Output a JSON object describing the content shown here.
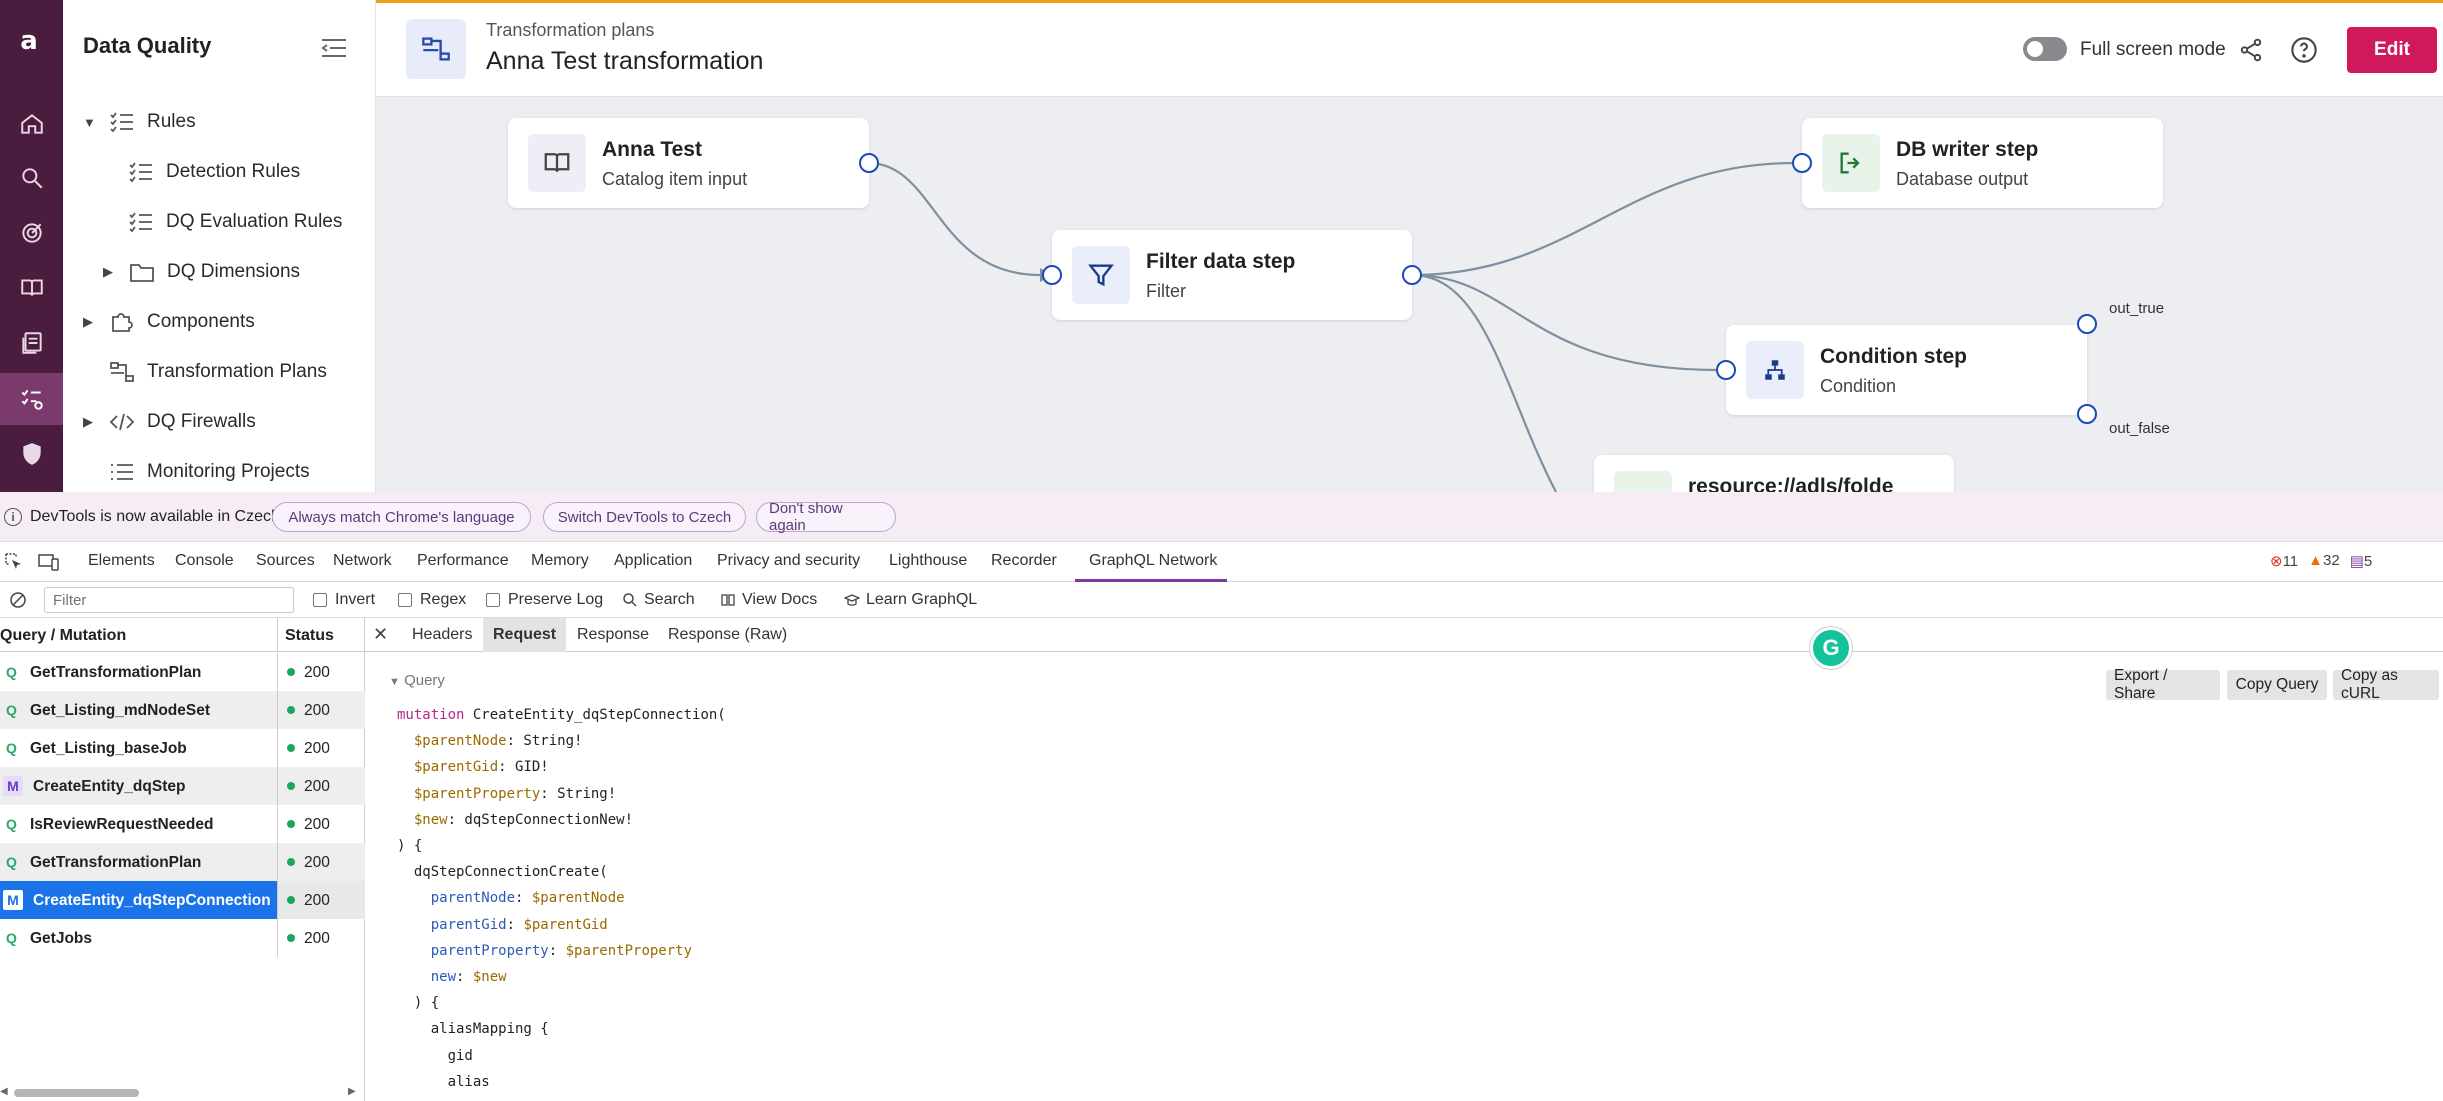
{
  "app": {
    "logo": "a",
    "sidenav": {
      "title": "Data Quality",
      "items": [
        {
          "label": "Rules",
          "caret": "▼"
        },
        {
          "label": "Detection Rules"
        },
        {
          "label": "DQ Evaluation Rules"
        },
        {
          "label": "DQ Dimensions",
          "caret": "▶"
        },
        {
          "label": "Components",
          "caret": "▶"
        },
        {
          "label": "Transformation Plans"
        },
        {
          "label": "DQ Firewalls",
          "caret": "▶"
        },
        {
          "label": "Monitoring Projects"
        }
      ]
    },
    "header": {
      "breadcrumb": "Transformation plans",
      "title": "Anna Test transformation",
      "fullscreen_label": "Full screen mode",
      "fullscreen_on": false,
      "edit_label": "Edit"
    },
    "nodes": [
      {
        "title": "Anna Test",
        "subtitle": "Catalog item input",
        "icon": "book-icon"
      },
      {
        "title": "Filter data step",
        "subtitle": "Filter",
        "icon": "filter-icon"
      },
      {
        "title": "DB writer step",
        "subtitle": "Database output",
        "icon": "output-icon"
      },
      {
        "title": "Condition step",
        "subtitle": "Condition",
        "icon": "hierarchy-icon"
      },
      {
        "title": "resource://adls/folde",
        "subtitle": "",
        "icon": ""
      }
    ],
    "port_labels": {
      "out_true": "out_true",
      "out_false": "out_false"
    },
    "colors": {
      "rail": "#4a1d3f",
      "edit_button": "#d0195d",
      "port": "#1a4bb4"
    }
  },
  "devtools": {
    "infobar": {
      "text": "DevTools is now available in Czech!",
      "buttons": [
        "Always match Chrome's language",
        "Switch DevTools to Czech",
        "Don't show again"
      ]
    },
    "tabs": [
      "Elements",
      "Console",
      "Sources",
      "Network",
      "Performance",
      "Memory",
      "Application",
      "Privacy and security",
      "Lighthouse",
      "Recorder",
      "GraphQL Network"
    ],
    "active_tab": "GraphQL Network",
    "counts": {
      "errors": "11",
      "warnings": "32",
      "messages": "5"
    },
    "toolbar": {
      "filter_placeholder": "Filter",
      "invert": "Invert",
      "regex": "Regex",
      "preserve_log": "Preserve Log",
      "search": "Search",
      "view_docs": "View Docs",
      "learn": "Learn GraphQL"
    },
    "list": {
      "col_name": "Query / Mutation",
      "col_status": "Status",
      "rows": [
        {
          "type": "Q",
          "name": "GetTransformationPlan",
          "status": "200"
        },
        {
          "type": "Q",
          "name": "Get_Listing_mdNodeSet",
          "status": "200"
        },
        {
          "type": "Q",
          "name": "Get_Listing_baseJob",
          "status": "200"
        },
        {
          "type": "M",
          "name": "CreateEntity_dqStep",
          "status": "200"
        },
        {
          "type": "Q",
          "name": "IsReviewRequestNeeded",
          "status": "200"
        },
        {
          "type": "Q",
          "name": "GetTransformationPlan",
          "status": "200"
        },
        {
          "type": "M",
          "name": "CreateEntity_dqStepConnection",
          "status": "200",
          "selected": true
        },
        {
          "type": "Q",
          "name": "GetJobs",
          "status": "200"
        }
      ]
    },
    "detail": {
      "close": "✕",
      "tabs": [
        "Headers",
        "Request",
        "Response",
        "Response (Raw)"
      ],
      "active_tab": "Request",
      "section": "Query",
      "actions": [
        "Export / Share",
        "Copy Query",
        "Copy as cURL"
      ],
      "grammarly": "G",
      "code": [
        "mutation CreateEntity_dqStepConnection(",
        "  $parentNode: String!",
        "  $parentGid: GID!",
        "  $parentProperty: String!",
        "  $new: dqStepConnectionNew!",
        ") {",
        "  dqStepConnectionCreate(",
        "    parentNode: $parentNode",
        "    parentGid: $parentGid",
        "    parentProperty: $parentProperty",
        "    new: $new",
        "  ) {",
        "    aliasMapping {",
        "      gid",
        "      alias"
      ]
    }
  }
}
